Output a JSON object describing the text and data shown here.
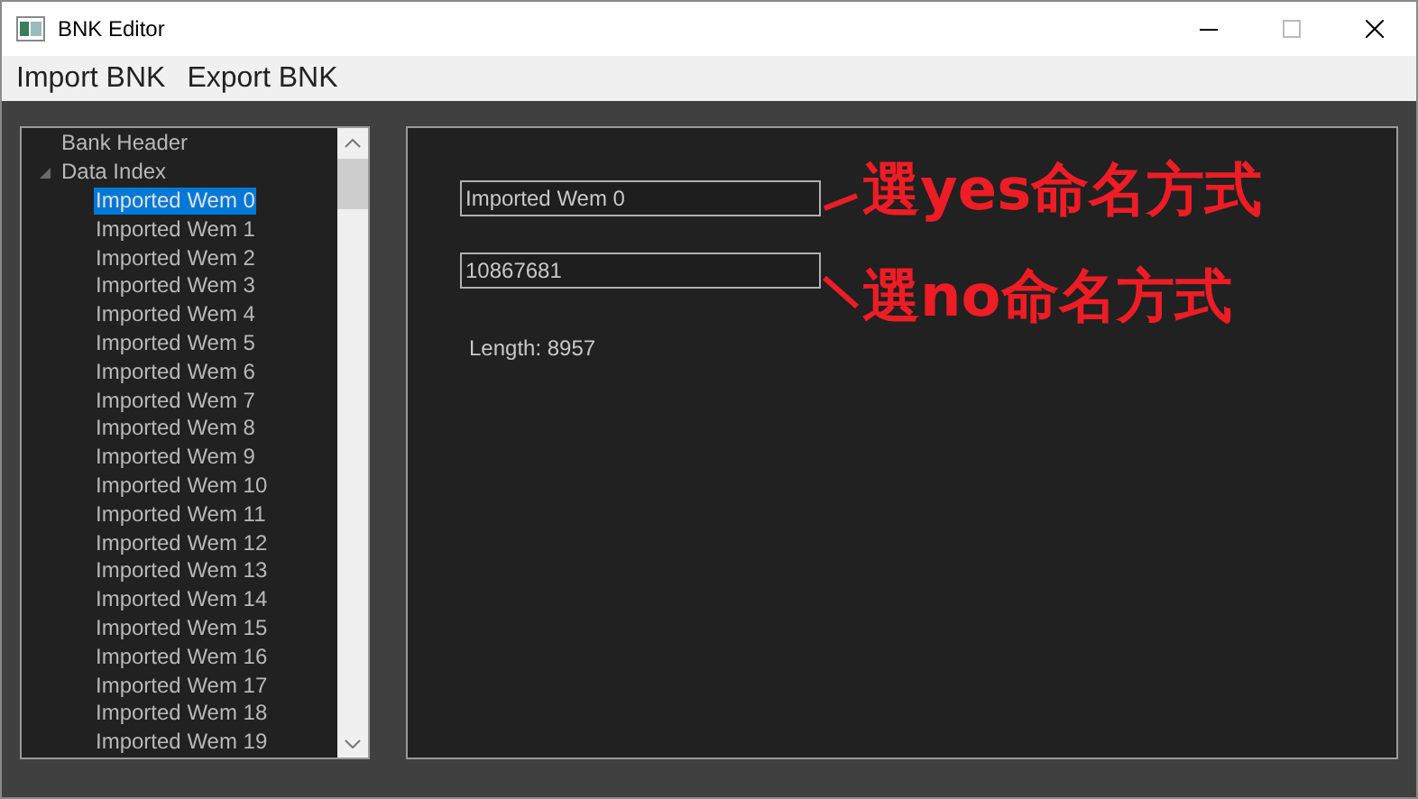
{
  "window": {
    "title": "BNK Editor"
  },
  "menu": [
    "Import BNK",
    "Export BNK"
  ],
  "tree": [
    {
      "label": "Bank Header"
    },
    {
      "label": "Data Index",
      "expanded": true,
      "children": [
        {
          "label": "Imported Wem 0",
          "selected": true
        },
        {
          "label": "Imported Wem 1",
          "selected": false
        },
        {
          "label": "Imported Wem 2",
          "selected": false
        },
        {
          "label": "Imported Wem 3",
          "selected": false
        },
        {
          "label": "Imported Wem 4",
          "selected": false
        },
        {
          "label": "Imported Wem 5",
          "selected": false
        },
        {
          "label": "Imported Wem 6",
          "selected": false
        },
        {
          "label": "Imported Wem 7",
          "selected": false
        },
        {
          "label": "Imported Wem 8",
          "selected": false
        },
        {
          "label": "Imported Wem 9",
          "selected": false
        },
        {
          "label": "Imported Wem 10",
          "selected": false
        },
        {
          "label": "Imported Wem 11",
          "selected": false
        },
        {
          "label": "Imported Wem 12",
          "selected": false
        },
        {
          "label": "Imported Wem 13",
          "selected": false
        },
        {
          "label": "Imported Wem 14",
          "selected": false
        },
        {
          "label": "Imported Wem 15",
          "selected": false
        },
        {
          "label": "Imported Wem 16",
          "selected": false
        },
        {
          "label": "Imported Wem 17",
          "selected": false
        },
        {
          "label": "Imported Wem 18",
          "selected": false
        },
        {
          "label": "Imported Wem 19",
          "selected": false
        }
      ]
    }
  ],
  "fields": [
    {
      "value": "Imported Wem 0"
    },
    {
      "value": "10867681"
    }
  ],
  "length": "Length: 8957",
  "annotations": [
    "選yes命名方式",
    "選no命名方式"
  ]
}
